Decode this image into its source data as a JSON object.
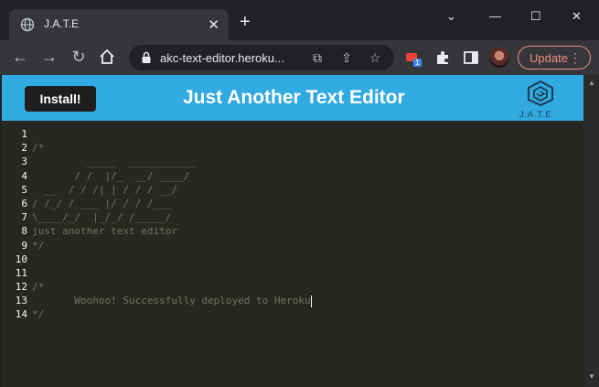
{
  "browser": {
    "tab_title": "J.A.T.E",
    "url": "akc-text-editor.heroku...",
    "update_label": "Update",
    "extension_badge": "1"
  },
  "app": {
    "install_label": "Install!",
    "title": "Just Another Text Editor",
    "logo_text": "J.A.T.E"
  },
  "editor": {
    "line_numbers": [
      "1",
      "2",
      "3",
      "4",
      "5",
      "6",
      "7",
      "8",
      "9",
      "10",
      "11",
      "12",
      "13",
      "14"
    ],
    "lines": [
      "",
      "/*",
      "         _____  ___________",
      "       / /  |/_  __/ ____/",
      "  __  / / /| | / / / __/",
      "/ /_/ / ___ |/ / / /___",
      "\\____/_/  |_/_/ /_____/",
      "just another text editor",
      "*/",
      "",
      "",
      "/*",
      "       Woohoo! Successfully deployed to Heroku",
      "*/"
    ]
  },
  "colors": {
    "header_bg": "#31a9e1",
    "editor_bg": "#272822",
    "comment": "#75715e"
  }
}
